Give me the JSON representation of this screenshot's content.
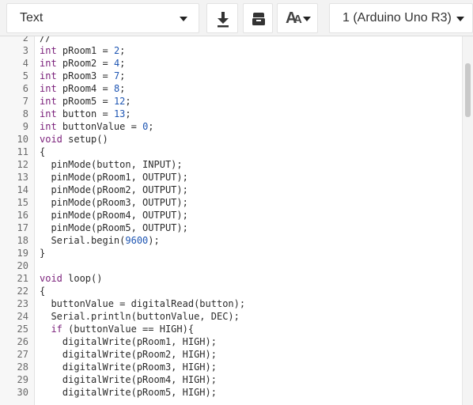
{
  "toolbar": {
    "mode": "Text",
    "download_icon": "download-icon",
    "library_icon": "library-box-icon",
    "font_size_icon": "font-size-icon",
    "font_big": "A",
    "font_small": "A",
    "board": "1 (Arduino Uno R3)"
  },
  "colors": {
    "keyword": "#7a1f7a",
    "number": "#1f56b3",
    "text": "#2b2b2b",
    "gutter": "#f7f7f7"
  },
  "editor": {
    "lines": [
      {
        "num": "2",
        "text": "//"
      },
      {
        "num": "3",
        "text": "int pRoom1 = 2;"
      },
      {
        "num": "4",
        "text": "int pRoom2 = 4;"
      },
      {
        "num": "5",
        "text": "int pRoom3 = 7;"
      },
      {
        "num": "6",
        "text": "int pRoom4 = 8;"
      },
      {
        "num": "7",
        "text": "int pRoom5 = 12;"
      },
      {
        "num": "8",
        "text": "int button = 13;"
      },
      {
        "num": "9",
        "text": "int buttonValue = 0;"
      },
      {
        "num": "10",
        "text": "void setup()"
      },
      {
        "num": "11",
        "text": "{"
      },
      {
        "num": "12",
        "text": "  pinMode(button, INPUT);"
      },
      {
        "num": "13",
        "text": "  pinMode(pRoom1, OUTPUT);"
      },
      {
        "num": "14",
        "text": "  pinMode(pRoom2, OUTPUT);"
      },
      {
        "num": "15",
        "text": "  pinMode(pRoom3, OUTPUT);"
      },
      {
        "num": "16",
        "text": "  pinMode(pRoom4, OUTPUT);"
      },
      {
        "num": "17",
        "text": "  pinMode(pRoom5, OUTPUT);"
      },
      {
        "num": "18",
        "text": "  Serial.begin(9600);"
      },
      {
        "num": "19",
        "text": "}"
      },
      {
        "num": "20",
        "text": ""
      },
      {
        "num": "21",
        "text": "void loop()"
      },
      {
        "num": "22",
        "text": "{"
      },
      {
        "num": "23",
        "text": "  buttonValue = digitalRead(button);"
      },
      {
        "num": "24",
        "text": "  Serial.println(buttonValue, DEC);"
      },
      {
        "num": "25",
        "text": "  if (buttonValue == HIGH){"
      },
      {
        "num": "26",
        "text": "    digitalWrite(pRoom1, HIGH);"
      },
      {
        "num": "27",
        "text": "    digitalWrite(pRoom2, HIGH);"
      },
      {
        "num": "28",
        "text": "    digitalWrite(pRoom3, HIGH);"
      },
      {
        "num": "29",
        "text": "    digitalWrite(pRoom4, HIGH);"
      },
      {
        "num": "30",
        "text": "    digitalWrite(pRoom5, HIGH);"
      }
    ]
  }
}
